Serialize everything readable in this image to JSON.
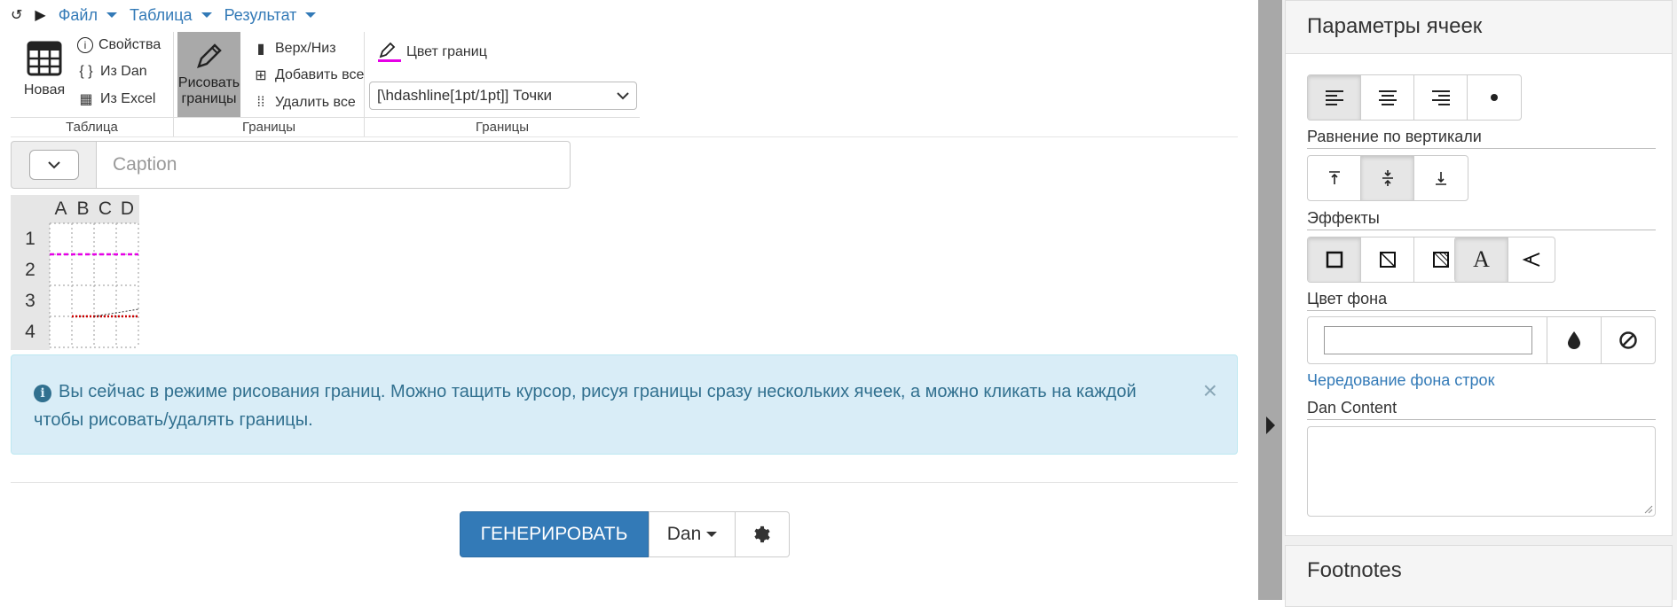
{
  "topmenu": {
    "items": [
      "Файл",
      "Таблица",
      "Результат"
    ]
  },
  "ribbon": {
    "table_group": {
      "label": "Таблица",
      "new_label": "Новая",
      "properties": "Свойства",
      "from_dan": "Из Dan",
      "from_excel": "Из Excel"
    },
    "borders_group": {
      "label": "Границы",
      "draw_line1": "Рисовать",
      "draw_line2": "границы",
      "top_bottom": "Верх/Низ",
      "add_all": "Добавить все",
      "remove_all": "Удалить все"
    },
    "borders_group2": {
      "label": "Границы",
      "border_color": "Цвет границ",
      "border_color_hex": "#e600e6",
      "style_select": "[\\hdashline[1pt/1pt]] Точки"
    }
  },
  "caption": {
    "placeholder": "Caption"
  },
  "grid": {
    "columns": [
      "A",
      "B",
      "C",
      "D"
    ],
    "rows": [
      "1",
      "2",
      "3",
      "4"
    ]
  },
  "alert": {
    "text": "Вы сейчас в режиме рисования границ. Можно тащить курсор, рисуя границы сразу нескольких ячеек, а можно кликать на каждой чтобы рисовать/удалять границы.",
    "close": "×"
  },
  "actions": {
    "generate": "ГЕНЕРИРОВАТЬ",
    "format": "Dan"
  },
  "side": {
    "title": "Параметры ячеек",
    "vertical_align_label": "Равнение по вертикали",
    "effects_label": "Эффекты",
    "bg_color_label": "Цвет фона",
    "row_stripe_link": "Чередование фона строк",
    "dan_content_label": "Dan Content",
    "footnotes_title": "Footnotes"
  },
  "colors": {
    "primary": "#337ab7",
    "alert_bg": "#d9edf7",
    "border_pink": "#e600e6",
    "border_red": "#cc0000"
  }
}
